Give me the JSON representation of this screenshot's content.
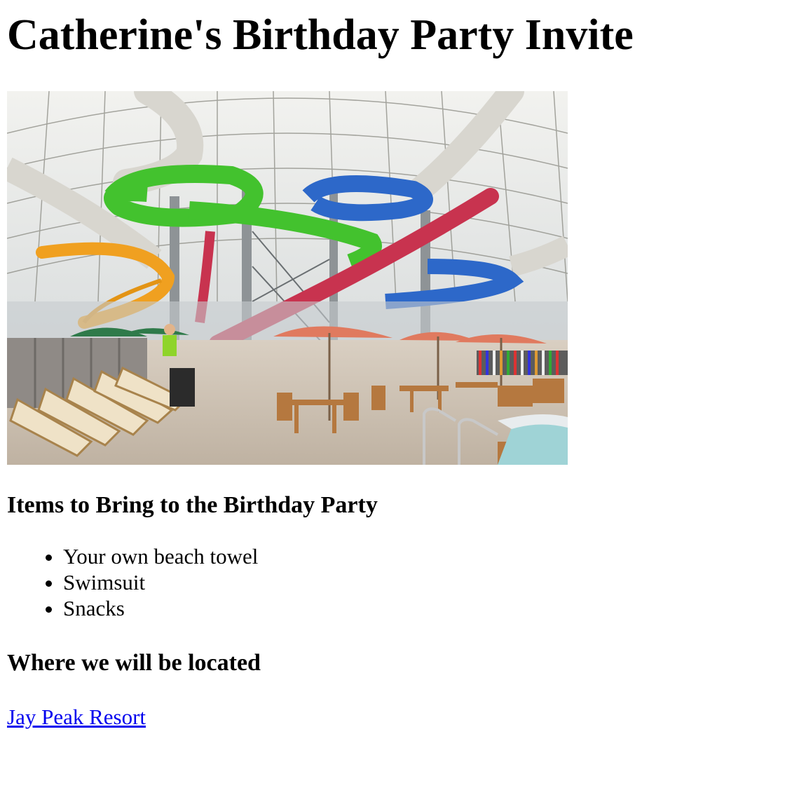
{
  "page": {
    "title": "Catherine's Birthday Party Invite"
  },
  "image": {
    "alt": "Indoor water park with colorful water slides, pool deck chairs and umbrellas"
  },
  "items": {
    "heading": "Items to Bring to the Birthday Party",
    "list": [
      "Your own beach towel",
      "Swimsuit",
      "Snacks"
    ]
  },
  "location": {
    "heading": "Where we will be located",
    "link_text": "Jay Peak Resort"
  },
  "colors": {
    "link": "#0000ee",
    "text": "#000000",
    "background": "#ffffff"
  }
}
